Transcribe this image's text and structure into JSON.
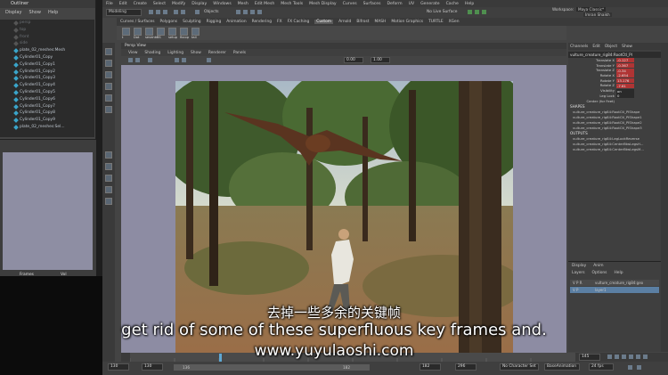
{
  "outliner": {
    "title": "Outliner",
    "menu": [
      "Display",
      "Show",
      "Help"
    ],
    "items": [
      {
        "label": "persp",
        "dim": true
      },
      {
        "label": "top",
        "dim": true
      },
      {
        "label": "front",
        "dim": true
      },
      {
        "label": "side",
        "dim": true
      },
      {
        "label": "plate_02_meshes:Mesh",
        "dim": false
      },
      {
        "label": "Cylinder01_Copy",
        "dim": false
      },
      {
        "label": "Cylinder01_Copy1",
        "dim": false
      },
      {
        "label": "Cylinder01_Copy2",
        "dim": false
      },
      {
        "label": "Cylinder01_Copy3",
        "dim": false
      },
      {
        "label": "Cylinder01_Copy4",
        "dim": false
      },
      {
        "label": "Cylinder01_Copy5",
        "dim": false
      },
      {
        "label": "Cylinder01_Copy6",
        "dim": false
      },
      {
        "label": "Cylinder01_Copy7",
        "dim": false
      },
      {
        "label": "Cylinder01_Copy8",
        "dim": false
      },
      {
        "label": "Cylinder01_Copy9",
        "dim": false
      },
      {
        "label": "plate_02_meshes:Sel...",
        "dim": false
      }
    ]
  },
  "graph": {
    "frames_label": "Frames",
    "frames_value": "Vol"
  },
  "menubar": [
    "File",
    "Edit",
    "Create",
    "Select",
    "Modify",
    "Display",
    "Windows",
    "Mesh",
    "Edit Mesh",
    "Mesh Tools",
    "Mesh Display",
    "Curves",
    "Surfaces",
    "Deform",
    "UV",
    "Generate",
    "Cache",
    "Help"
  ],
  "status": {
    "mode": "Modeling",
    "objects": "Objects",
    "live_surface": "No Live Surface",
    "workspace_label": "Workspace:",
    "workspace": "Maya Classic*",
    "user": "Imran Shaikh"
  },
  "shelf_tabs": [
    "Curves / Surfaces",
    "Polygons",
    "Sculpting",
    "Rigging",
    "Animation",
    "Rendering",
    "FX",
    "FX Caching",
    "Custom",
    "Arnold",
    "Bifrost",
    "MASH",
    "Motion Graphics",
    "TURTLE",
    "XGen"
  ],
  "shelf_active": "Custom",
  "shelf_buttons": [
    "t",
    "Dot",
    "seventr",
    "BS",
    "setup",
    "fbcop",
    "tail"
  ],
  "viewport": {
    "panel_title": "Persp View",
    "menu": [
      "View",
      "Shading",
      "Lighting",
      "Show",
      "Renderer",
      "Panels"
    ],
    "field_a": "0.00",
    "field_b": "1.00"
  },
  "channel_box": {
    "tabs": [
      "Channels",
      "Edit",
      "Object",
      "Show"
    ],
    "object": "vulture_creature_rig84:RootCtl_PI",
    "attributes": [
      {
        "name": "Translate X",
        "value": "-0.127",
        "keyed": true
      },
      {
        "name": "Translate Y",
        "value": "-0.367",
        "keyed": true
      },
      {
        "name": "Translate Z",
        "value": "-0.34",
        "keyed": true
      },
      {
        "name": "Rotate X",
        "value": "-2.654",
        "keyed": true
      },
      {
        "name": "Rotate Y",
        "value": "13.176",
        "keyed": true
      },
      {
        "name": "Rotate Z",
        "value": "-7.61",
        "keyed": true
      },
      {
        "name": "Visibility",
        "value": "on",
        "keyed": false
      },
      {
        "name": "Leg Lock",
        "value": "0",
        "keyed": false
      },
      {
        "name": "Center (for Feet)",
        "value": "",
        "keyed": false
      }
    ],
    "shapes_label": "SHAPES",
    "shapes": [
      "vulture_creature_rig84:RootCtl_PIShape",
      "vulture_creature_rig84:RootCtl_PIShape1",
      "vulture_creature_rig84:RootCtl_PIShape2",
      "vulture_creature_rig84:RootCtl_PIShape3"
    ],
    "outputs_label": "OUTPUTS",
    "outputs": [
      "vulture_creature_rig84:LegLockReverse",
      "vulture_creature_rig84:CenterBtwLegsH...",
      "vulture_creature_rig84:CenterBtwLegsM..."
    ]
  },
  "layer_editor": {
    "tabs": [
      "Display",
      "Anim"
    ],
    "menu": [
      "Layers",
      "Options",
      "Help"
    ],
    "layers": [
      {
        "flags": "V P R",
        "name": "vulture_creature_rig84:geo"
      },
      {
        "flags": "V P",
        "name": "layer1"
      }
    ]
  },
  "timeline": {
    "start": "130",
    "start_inner": "130",
    "range_start": "136",
    "range_end": "182",
    "end_inner": "182",
    "end": "296",
    "current": "145",
    "character_set": "No Character Set",
    "anim_layer": "BaseAnimation",
    "fps": "24 fps"
  },
  "subtitles": {
    "zh": "去掉一些多余的关键帧",
    "en": "get rid of some of these superfluous key frames and.",
    "url": "www.yuyulaoshi.com"
  }
}
